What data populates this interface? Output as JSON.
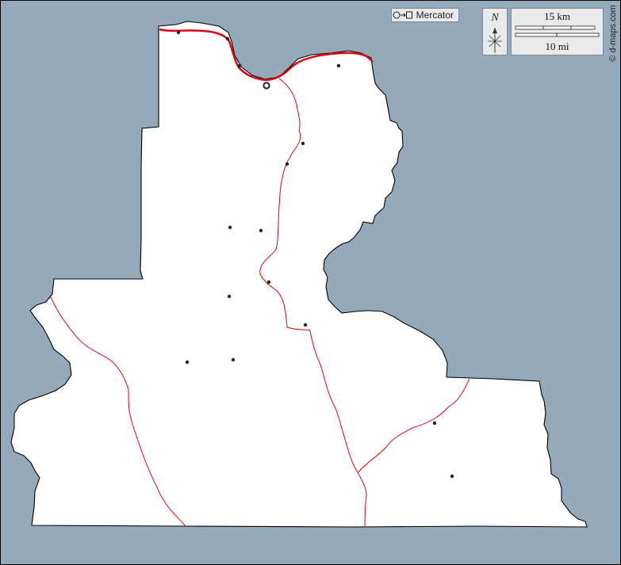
{
  "projection": {
    "label": "Mercator"
  },
  "north": {
    "label": "N"
  },
  "scale": {
    "km_label": "15 km",
    "mi_label": "10 mi"
  },
  "credit": {
    "text": "© d-maps.com"
  },
  "colors": {
    "water": "#94a9ba",
    "land": "#ffffff",
    "border": "#000000",
    "river": "#e8000b",
    "main_river": "#dd0010"
  },
  "icons": {
    "projection": "circle-to-square-icon",
    "north": "compass-arrow-icon"
  }
}
